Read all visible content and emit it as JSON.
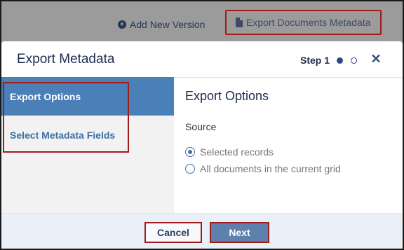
{
  "toolbar": {
    "add_version_label": "Add New Version",
    "export_metadata_label": "Export Documents Metadata",
    "add_icon": "plus-circle-icon",
    "export_icon": "document-icon"
  },
  "modal": {
    "title": "Export Metadata",
    "step_label": "Step 1",
    "steps_total": 2,
    "current_step": 1,
    "close_icon": "close-icon"
  },
  "sidebar": {
    "items": [
      {
        "label": "Export Options",
        "active": true
      },
      {
        "label": "Select Metadata Fields",
        "active": false
      }
    ]
  },
  "content": {
    "title": "Export Options",
    "source_label": "Source",
    "options": [
      {
        "label": "Selected records",
        "checked": true
      },
      {
        "label": "All documents in the current grid",
        "checked": false
      }
    ]
  },
  "footer": {
    "cancel_label": "Cancel",
    "next_label": "Next"
  },
  "colors": {
    "accent": "#4a7fb7",
    "primary_text": "#1d2d4f",
    "highlight_border": "#a21b1b",
    "next_button": "#5e80ad"
  }
}
